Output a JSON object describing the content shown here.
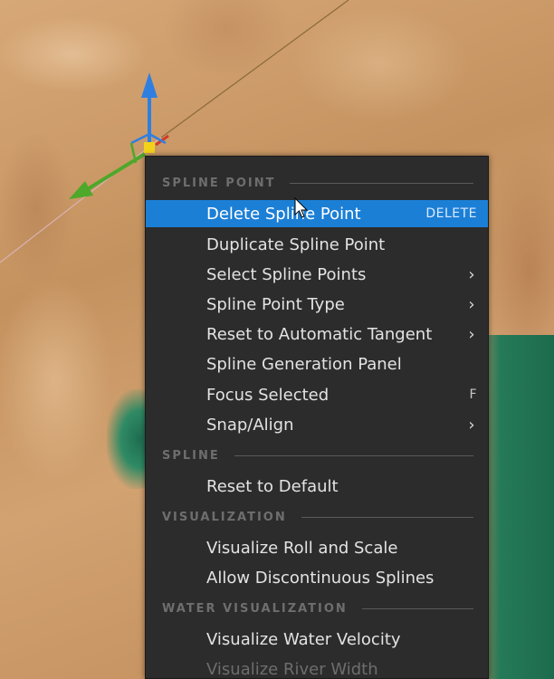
{
  "menu": {
    "sections": {
      "spline_point": "SPLINE POINT",
      "spline": "SPLINE",
      "visualization": "VISUALIZATION",
      "water_visualization": "WATER VISUALIZATION"
    },
    "items": [
      {
        "label": "Delete Spline Point",
        "shortcut": "DELETE",
        "submenu": false,
        "highlighted": true
      },
      {
        "label": "Duplicate Spline Point",
        "shortcut": "",
        "submenu": false
      },
      {
        "label": "Select Spline Points",
        "shortcut": "",
        "submenu": true
      },
      {
        "label": "Spline Point Type",
        "shortcut": "",
        "submenu": true
      },
      {
        "label": "Reset to Automatic Tangent",
        "shortcut": "",
        "submenu": true
      },
      {
        "label": "Spline Generation Panel",
        "shortcut": "",
        "submenu": false
      },
      {
        "label": "Focus Selected",
        "shortcut": "F",
        "submenu": false
      },
      {
        "label": "Snap/Align",
        "shortcut": "",
        "submenu": true
      },
      {
        "label": "Reset to Default",
        "shortcut": "",
        "submenu": false
      },
      {
        "label": "Visualize Roll and Scale",
        "shortcut": "",
        "submenu": false
      },
      {
        "label": "Allow Discontinuous Splines",
        "shortcut": "",
        "submenu": false
      },
      {
        "label": "Visualize Water Velocity",
        "shortcut": "",
        "submenu": false
      },
      {
        "label": "Visualize River Width",
        "shortcut": "",
        "submenu": false,
        "disabled": true
      }
    ],
    "chevron_icon": "chevron-right-icon"
  },
  "colors": {
    "highlight": "#1c7fd6",
    "menu_bg": "#2c2c2c",
    "gizmo_z": "#2f7fe0",
    "gizmo_x": "#4ea82a",
    "gizmo_center": "#f2d21a"
  }
}
